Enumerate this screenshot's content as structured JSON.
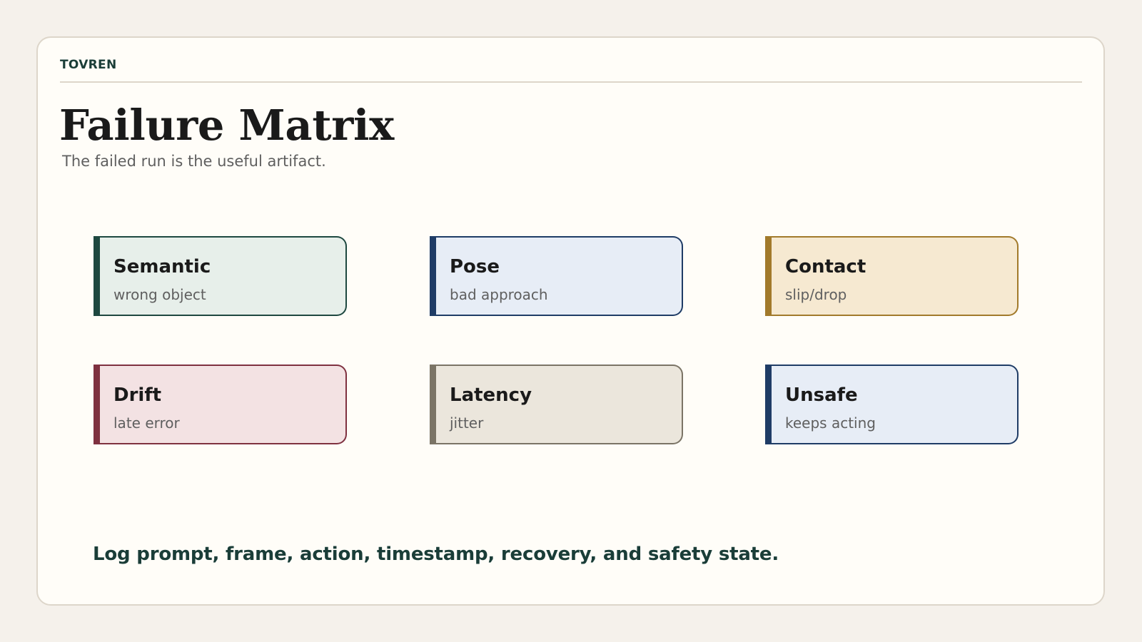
{
  "brand": "TOVREN",
  "title": "Failure Matrix",
  "subtitle": "The failed run is the useful artifact.",
  "cards": [
    {
      "title": "Semantic",
      "subtitle": "wrong object",
      "accent": "#1e4840",
      "fill": "#e7efea"
    },
    {
      "title": "Pose",
      "subtitle": "bad approach",
      "accent": "#1f3c66",
      "fill": "#e7edf6"
    },
    {
      "title": "Contact",
      "subtitle": "slip/drop",
      "accent": "#a27a2b",
      "fill": "#f6e9d1"
    },
    {
      "title": "Drift",
      "subtitle": "late error",
      "accent": "#7f3140",
      "fill": "#f3e2e3"
    },
    {
      "title": "Latency",
      "subtitle": "jitter",
      "accent": "#7b7466",
      "fill": "#ebe6dc"
    },
    {
      "title": "Unsafe",
      "subtitle": "keeps acting",
      "accent": "#1f3c66",
      "fill": "#e7edf6"
    }
  ],
  "footer": "Log prompt, frame, action, timestamp, recovery, and safety state."
}
